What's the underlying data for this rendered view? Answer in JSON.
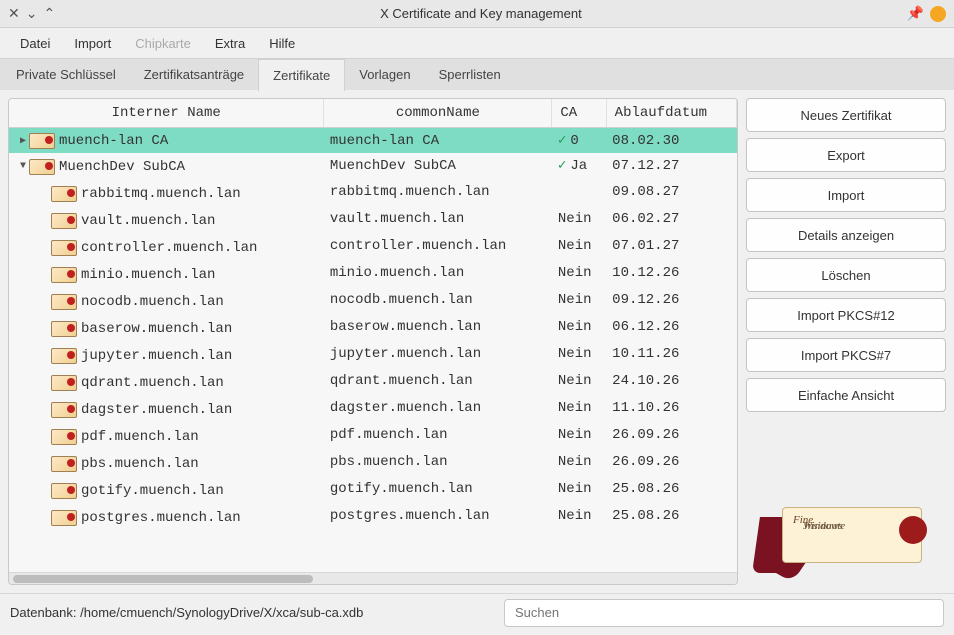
{
  "titlebar": {
    "title": "X Certificate and Key management"
  },
  "menu": {
    "file": "Datei",
    "import": "Import",
    "chipcard": "Chipkarte",
    "extra": "Extra",
    "help": "Hilfe"
  },
  "tabs": {
    "private_keys": "Private Schlüssel",
    "csr": "Zertifikatsanträge",
    "certs": "Zertifikate",
    "templates": "Vorlagen",
    "crl": "Sperrlisten",
    "active": "certs"
  },
  "columns": {
    "name": "Interner Name",
    "cn": "commonName",
    "ca": "CA",
    "expiry": "Ablaufdatum"
  },
  "rows": [
    {
      "indent": 0,
      "arrow": "right",
      "selected": true,
      "name": "muench-lan CA",
      "cn": "muench-lan CA",
      "ca_check": true,
      "ca_text": "0",
      "exp": "08.02.30"
    },
    {
      "indent": 0,
      "arrow": "down",
      "selected": false,
      "name": "MuenchDev SubCA",
      "cn": "MuenchDev SubCA",
      "ca_check": true,
      "ca_text": "Ja",
      "exp": "07.12.27"
    },
    {
      "indent": 1,
      "arrow": "",
      "selected": false,
      "name": "rabbitmq.muench.lan",
      "cn": "rabbitmq.muench.lan",
      "ca_check": false,
      "ca_text": "",
      "exp": "09.08.27"
    },
    {
      "indent": 1,
      "arrow": "",
      "selected": false,
      "name": "vault.muench.lan",
      "cn": "vault.muench.lan",
      "ca_check": false,
      "ca_text": "Nein",
      "exp": "06.02.27"
    },
    {
      "indent": 1,
      "arrow": "",
      "selected": false,
      "name": "controller.muench.lan",
      "cn": "controller.muench.lan",
      "ca_check": false,
      "ca_text": "Nein",
      "exp": "07.01.27"
    },
    {
      "indent": 1,
      "arrow": "",
      "selected": false,
      "name": "minio.muench.lan",
      "cn": "minio.muench.lan",
      "ca_check": false,
      "ca_text": "Nein",
      "exp": "10.12.26"
    },
    {
      "indent": 1,
      "arrow": "",
      "selected": false,
      "name": "nocodb.muench.lan",
      "cn": "nocodb.muench.lan",
      "ca_check": false,
      "ca_text": "Nein",
      "exp": "09.12.26"
    },
    {
      "indent": 1,
      "arrow": "",
      "selected": false,
      "name": "baserow.muench.lan",
      "cn": "baserow.muench.lan",
      "ca_check": false,
      "ca_text": "Nein",
      "exp": "06.12.26"
    },
    {
      "indent": 1,
      "arrow": "",
      "selected": false,
      "name": "jupyter.muench.lan",
      "cn": "jupyter.muench.lan",
      "ca_check": false,
      "ca_text": "Nein",
      "exp": "10.11.26"
    },
    {
      "indent": 1,
      "arrow": "",
      "selected": false,
      "name": "qdrant.muench.lan",
      "cn": "qdrant.muench.lan",
      "ca_check": false,
      "ca_text": "Nein",
      "exp": "24.10.26"
    },
    {
      "indent": 1,
      "arrow": "",
      "selected": false,
      "name": "dagster.muench.lan",
      "cn": "dagster.muench.lan",
      "ca_check": false,
      "ca_text": "Nein",
      "exp": "11.10.26"
    },
    {
      "indent": 1,
      "arrow": "",
      "selected": false,
      "name": "pdf.muench.lan",
      "cn": "pdf.muench.lan",
      "ca_check": false,
      "ca_text": "Nein",
      "exp": "26.09.26"
    },
    {
      "indent": 1,
      "arrow": "",
      "selected": false,
      "name": "pbs.muench.lan",
      "cn": "pbs.muench.lan",
      "ca_check": false,
      "ca_text": "Nein",
      "exp": "26.09.26"
    },
    {
      "indent": 1,
      "arrow": "",
      "selected": false,
      "name": "gotify.muench.lan",
      "cn": "gotify.muench.lan",
      "ca_check": false,
      "ca_text": "Nein",
      "exp": "25.08.26"
    },
    {
      "indent": 1,
      "arrow": "",
      "selected": false,
      "name": "postgres.muench.lan",
      "cn": "postgres.muench.lan",
      "ca_check": false,
      "ca_text": "Nein",
      "exp": "25.08.26"
    }
  ],
  "buttons": {
    "new_cert": "Neues Zertifikat",
    "export": "Export",
    "import": "Import",
    "details": "Details anzeigen",
    "delete": "Löschen",
    "pkcs12": "Import PKCS#12",
    "pkcs7": "Import PKCS#7",
    "plain_view": "Einfache Ansicht"
  },
  "status": {
    "db_label": "Datenbank:",
    "db_path": "/home/cmuench/SynologyDrive/X/xca/sub-ca.xdb",
    "search_placeholder": "Suchen"
  },
  "logo": {
    "line1": "Jnsinuate",
    "line2": "Windows",
    "fine": "Fine"
  }
}
